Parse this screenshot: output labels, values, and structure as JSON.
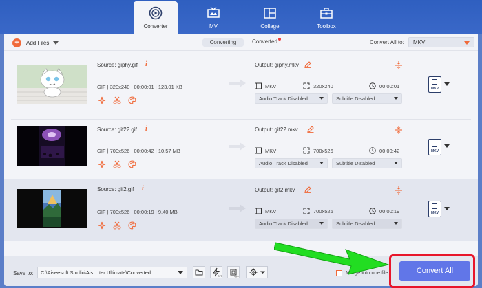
{
  "nav": {
    "tabs": [
      {
        "label": "Converter",
        "icon": "converter-icon",
        "active": true
      },
      {
        "label": "MV",
        "icon": "mv-icon"
      },
      {
        "label": "Collage",
        "icon": "collage-icon"
      },
      {
        "label": "Toolbox",
        "icon": "toolbox-icon"
      }
    ]
  },
  "toolbar": {
    "add_files": "Add Files",
    "tab_converting": "Converting",
    "tab_converted": "Converted",
    "convert_all_to": "Convert All to:",
    "format": "MKV"
  },
  "files": [
    {
      "source": "Source: giphy.gif",
      "info": "GIF  |  320x240  |  00:00:01  |  123.01 KB",
      "output": "Output: giphy.mkv",
      "out_format": "MKV",
      "out_res": "320x240",
      "out_dur": "00:00:01",
      "audio": "Audio Track Disabled",
      "subtitle": "Subtitle Disabled",
      "format_badge": "MKV"
    },
    {
      "source": "Source: gif22.gif",
      "info": "GIF  |  700x526  |  00:00:42  |  10.57 MB",
      "output": "Output: gif22.mkv",
      "out_format": "MKV",
      "out_res": "700x526",
      "out_dur": "00:00:42",
      "audio": "Audio Track Disabled",
      "subtitle": "Subtitle Disabled",
      "format_badge": "MKV"
    },
    {
      "source": "Source: gif2.gif",
      "info": "GIF  |  700x526  |  00:00:19  |  9.40 MB",
      "output": "Output: gif2.mkv",
      "out_format": "MKV",
      "out_res": "700x526",
      "out_dur": "00:00:19",
      "audio": "Audio Track Disabled",
      "subtitle": "Subtitle Disabled",
      "format_badge": "MKV"
    }
  ],
  "bottom": {
    "save_to": "Save to:",
    "path": "C:\\Aiseesoft Studio\\Ais...rter Ultimate\\Converted",
    "merge": "Merge into one file",
    "convert_all": "Convert All"
  },
  "colors": {
    "accent": "#f06a3a",
    "primary_button": "#6176e8",
    "nav_bg": "#2f5fc0",
    "highlight": "#e8162b",
    "arrow": "#22dd22"
  }
}
